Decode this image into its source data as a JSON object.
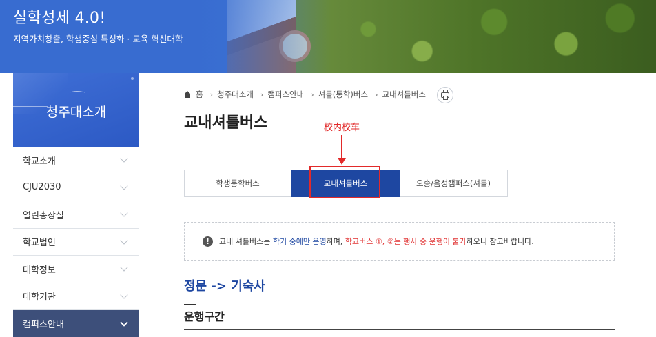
{
  "banner": {
    "title": "실학성세 4.0!",
    "subtitle": "지역가치창출, 학생중심 특성화 · 교육 혁신대학"
  },
  "sidebar": {
    "title": "청주대소개",
    "items": [
      {
        "label": "학교소개"
      },
      {
        "label": "CJU2030"
      },
      {
        "label": "열린총장실"
      },
      {
        "label": "학교법인"
      },
      {
        "label": "대학정보"
      },
      {
        "label": "대학기관"
      },
      {
        "label": "캠퍼스안내",
        "active": true
      }
    ]
  },
  "breadcrumb": [
    "홈",
    "청주대소개",
    "캠퍼스안내",
    "셔틀(통학)버스",
    "교내셔틀버스"
  ],
  "page_title": "교내셔틀버스",
  "annotation": {
    "text": "校内校车",
    "color": "#e22a2a"
  },
  "tabs": [
    {
      "label": "학생통학버스",
      "active": false
    },
    {
      "label": "교내셔틀버스",
      "active": true
    },
    {
      "label": "오송/음성캠퍼스(셔틀)",
      "active": false
    }
  ],
  "notice": {
    "icon": "info-icon",
    "part1": "교내 셔틀버스는 ",
    "part2": "학기 중에만 운영",
    "part3": "하며, ",
    "part4": "학교버스 ①, ②는 행사 중 운행이 불가",
    "part5": "하오니 참고바랍니다."
  },
  "route_title": "정문 -> 기숙사",
  "section_title": "운행구간",
  "colors": {
    "primary": "#1e47a1",
    "accent_red": "#e22a2a",
    "sidebar_active": "#3d4f7a"
  }
}
